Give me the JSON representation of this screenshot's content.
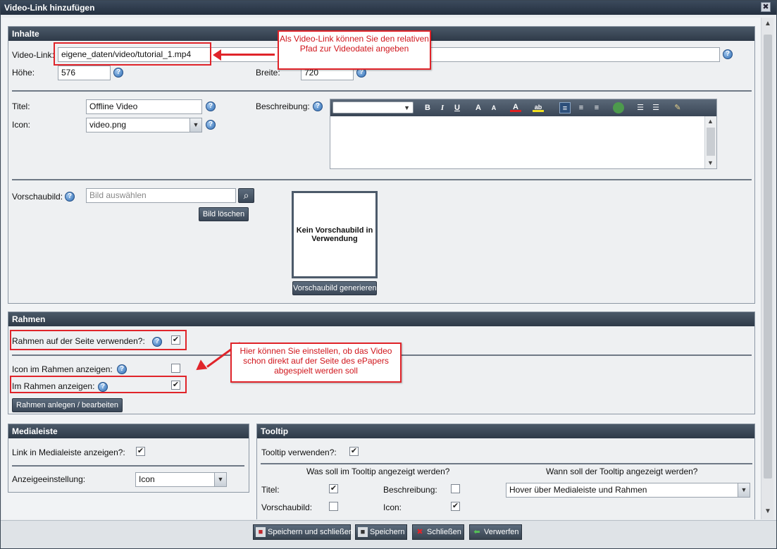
{
  "window": {
    "title": "Video-Link hinzufügen",
    "close_glyph": "✖"
  },
  "inhalte": {
    "header": "Inhalte",
    "video_link_label": "Video-Link:",
    "video_link_value": "eigene_daten/video/tutorial_1.mp4",
    "hoehe_label": "Höhe:",
    "hoehe_value": "576",
    "breite_label": "Breite:",
    "breite_value": "720",
    "titel_label": "Titel:",
    "titel_value": "Offline Video",
    "icon_label": "Icon:",
    "icon_value": "video.png",
    "beschreibung_label": "Beschreibung:",
    "vorschaubild_label": "Vorschaubild:",
    "vorschaubild_placeholder": "Bild auswählen",
    "bild_loeschen": "Bild löschen",
    "preview_text": "Kein Vorschaubild in Verwendung",
    "vorschaubild_generieren": "Vorschaubild generieren",
    "callout": "Als Video-Link können Sie den relativen Pfad zur Videodatei angeben"
  },
  "rahmen": {
    "header": "Rahmen",
    "rahmen_verwenden_label": "Rahmen auf der Seite verwenden?:",
    "rahmen_verwenden_checked": "✔",
    "icon_im_rahmen_label": "Icon im Rahmen anzeigen:",
    "icon_im_rahmen_checked": "",
    "im_rahmen_label": "Im Rahmen anzeigen:",
    "im_rahmen_checked": "✔",
    "rahmen_button": "Rahmen anlegen / bearbeiten",
    "callout": "Hier können Sie einstellen, ob das Video schon direkt auf der Seite des ePapers abgespielt werden soll"
  },
  "medialeiste": {
    "header": "Medialeiste",
    "link_label": "Link in Medialeiste anzeigen?:",
    "link_checked": "✔",
    "anzeige_label": "Anzeigeeinstellung:",
    "anzeige_value": "Icon"
  },
  "tooltip": {
    "header": "Tooltip",
    "verwenden_label": "Tooltip verwenden?:",
    "verwenden_checked": "✔",
    "was_heading": "Was soll im Tooltip angezeigt werden?",
    "wann_heading": "Wann soll der Tooltip angezeigt werden?",
    "titel_label": "Titel:",
    "titel_checked": "✔",
    "beschreibung_label": "Beschreibung:",
    "beschreibung_checked": "",
    "vorschaubild_label": "Vorschaubild:",
    "vorschaubild_checked": "",
    "icon_label": "Icon:",
    "icon_checked": "✔",
    "wann_value": "Hover über Medialeiste und Rahmen"
  },
  "footer": {
    "save_close": "Speichern und schließen",
    "save": "Speichern",
    "close": "Schließen",
    "discard": "Verwerfen"
  },
  "glyphs": {
    "help": "?",
    "dropdown": "▼",
    "magnifier": "⌕",
    "up": "▲",
    "down": "▼"
  }
}
